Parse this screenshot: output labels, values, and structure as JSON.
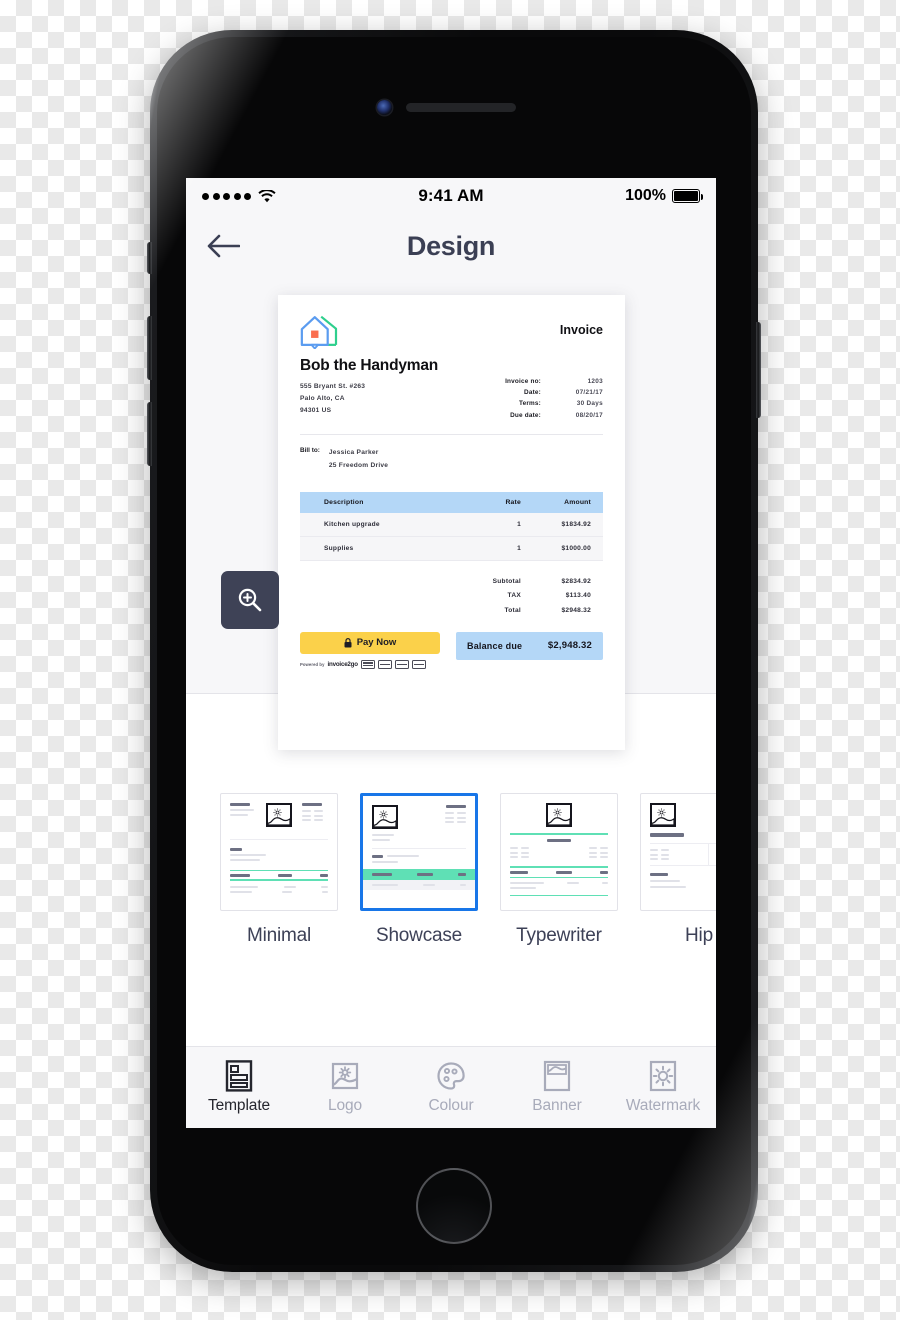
{
  "status_bar": {
    "signal_dots": 5,
    "wifi_icon": "wifi-icon",
    "time": "9:41 AM",
    "battery_percent": "100%",
    "battery_icon": "battery-full-icon"
  },
  "nav": {
    "back_icon": "arrow-left-icon",
    "title": "Design"
  },
  "preview": {
    "zoom_icon": "magnify-plus-icon",
    "invoice": {
      "logo_icon": "house-logo-icon",
      "heading": "Invoice",
      "company": "Bob the Handyman",
      "address": [
        "555 Bryant St. #263",
        "Palo Alto, CA",
        "94301 US"
      ],
      "meta": [
        {
          "key": "Invoice no:",
          "value": "1203"
        },
        {
          "key": "Date:",
          "value": "07/21/17"
        },
        {
          "key": "Terms:",
          "value": "30 Days"
        },
        {
          "key": "Due date:",
          "value": "08/20/17"
        }
      ],
      "bill_to_label": "Bill to:",
      "bill_to": [
        "Jessica Parker",
        "25 Freedom Drive"
      ],
      "table": {
        "headers": [
          "Description",
          "Rate",
          "Amount"
        ],
        "rows": [
          [
            "Kitchen upgrade",
            "1",
            "$1834.92"
          ],
          [
            "Supplies",
            "1",
            "$1000.00"
          ]
        ],
        "header_bg": "#b4d7f7"
      },
      "totals": [
        {
          "key": "Subtotal",
          "value": "$2834.92"
        },
        {
          "key": "TAX",
          "value": "$113.40"
        },
        {
          "key": "Total",
          "value": "$2948.32"
        }
      ],
      "pay_button": {
        "label": "Pay Now",
        "icon": "lock-icon",
        "color": "#fbd14a"
      },
      "powered_by": {
        "prefix": "Powered by",
        "brand": "invoice2go",
        "cards": [
          "amex-card-icon",
          "discover-card-icon",
          "visa-card-icon",
          "generic-card-icon"
        ]
      },
      "balance": {
        "label": "Balance due",
        "value": "$2,948.32",
        "bg": "#b4d7f7"
      }
    }
  },
  "templates": {
    "selected": "Showcase",
    "selected_border": "#1876e8",
    "accent": "#5fe0b5",
    "items": [
      {
        "label": "Minimal",
        "selected": false
      },
      {
        "label": "Showcase",
        "selected": true
      },
      {
        "label": "Typewriter",
        "selected": false
      },
      {
        "label": "Hip",
        "selected": false
      }
    ]
  },
  "tabbar": {
    "active": "Template",
    "items": [
      {
        "label": "Template",
        "icon": "template-layout-icon",
        "active": true
      },
      {
        "label": "Logo",
        "icon": "image-picture-icon",
        "active": false
      },
      {
        "label": "Colour",
        "icon": "palette-icon",
        "active": false
      },
      {
        "label": "Banner",
        "icon": "banner-icon",
        "active": false
      },
      {
        "label": "Watermark",
        "icon": "sun-watermark-icon",
        "active": false
      }
    ]
  }
}
